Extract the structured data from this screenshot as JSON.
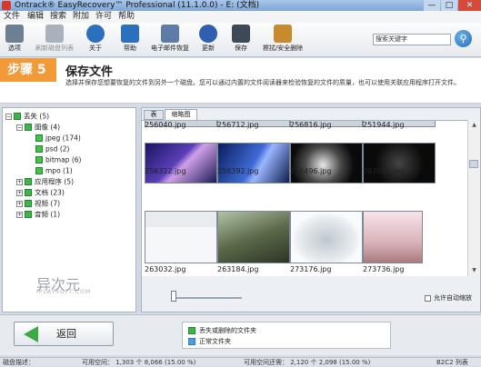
{
  "window": {
    "title": "Ontrack® EasyRecovery™ Professional (11.1.0.0) - E: (文档)",
    "min": "—",
    "max": "□",
    "close": "✕"
  },
  "menu": [
    "文件",
    "编辑",
    "搜索",
    "附加",
    "许可",
    "帮助"
  ],
  "toolbar": [
    {
      "label": "选项",
      "icon": "wrench-screwdriver-icon",
      "color": "#6d7f93",
      "enabled": true
    },
    {
      "label": "刷新磁盘列表",
      "icon": "disk-refresh-icon",
      "color": "#a9b1bb",
      "enabled": false
    },
    {
      "label": "关于",
      "icon": "info-icon",
      "color": "#2b6fbf",
      "enabled": true
    },
    {
      "label": "帮助",
      "icon": "help-icon",
      "color": "#2b6fbf",
      "enabled": true
    },
    {
      "label": "电子邮件恢复",
      "icon": "email-recovery-icon",
      "color": "#5d7da8",
      "enabled": true
    },
    {
      "label": "更新",
      "icon": "update-icon",
      "color": "#2f5fae",
      "enabled": true
    },
    {
      "label": "保存",
      "icon": "save-icon",
      "color": "#3d4956",
      "enabled": true
    },
    {
      "label": "擦拭/安全删除",
      "icon": "broom-icon",
      "color": "#c9892d",
      "enabled": true
    }
  ],
  "search": {
    "placeholder": "搜索关键字",
    "button_icon": "search-icon"
  },
  "step": {
    "label": "步骤 5",
    "title": "保存文件",
    "description": "选择并保存您想要恢复的文件到另外一个磁盘。您可以通过内置的文件阅读器来检验恢复的文件的质量，也可以使用关联应用程序打开文件。"
  },
  "tree": [
    {
      "label": "丢失",
      "count": "(5)",
      "level": 0,
      "expander": "−"
    },
    {
      "label": "图像",
      "count": "(4)",
      "level": 1,
      "expander": "−"
    },
    {
      "label": "jpeg",
      "count": "(174)",
      "level": 2,
      "expander": ""
    },
    {
      "label": "psd",
      "count": "(2)",
      "level": 2,
      "expander": ""
    },
    {
      "label": "bitmap",
      "count": "(6)",
      "level": 2,
      "expander": ""
    },
    {
      "label": "mpo",
      "count": "(1)",
      "level": 2,
      "expander": ""
    },
    {
      "label": "应用程序",
      "count": "(5)",
      "level": 1,
      "expander": "+"
    },
    {
      "label": "文档",
      "count": "(23)",
      "level": 1,
      "expander": "+"
    },
    {
      "label": "视频",
      "count": "(7)",
      "level": 1,
      "expander": "+"
    },
    {
      "label": "音频",
      "count": "(1)",
      "level": 1,
      "expander": "+"
    }
  ],
  "watermark": {
    "logo": "异次元",
    "sub": "IPLAYSOFT.COM"
  },
  "tabs": {
    "table": "表",
    "thumbnails": "缩略图"
  },
  "thumbnails": [
    {
      "name": "256040.jpg",
      "bg": "#cdd3da"
    },
    {
      "name": "256712.jpg",
      "bg": "#cfd5dc"
    },
    {
      "name": "256816.jpg",
      "bg": "#ccd2d9"
    },
    {
      "name": "251944.jpg",
      "bg": "#d0d6dd"
    },
    {
      "name": "256312.jpg",
      "bg": "linear-gradient(135deg,#1a1460,#5a3fb8 45%,#d0a0e8 55%,#1a1a55)"
    },
    {
      "name": "256392.jpg",
      "bg": "linear-gradient(120deg,#0b1c5a,#3f6bd6 50%,#9ab6ff 60%,#0e1d4c)"
    },
    {
      "name": "256496.jpg",
      "bg": "radial-gradient(circle at 45% 55%,#e8e8e8,#4a4a4a 40%,#0a0a0a 70%)"
    },
    {
      "name": "262632.jpg",
      "bg": "radial-gradient(circle at 50% 50%,#444,#0a0a0a 60%)"
    },
    {
      "name": "263032.jpg",
      "bg": "linear-gradient(#e9ecef 30%,#f6f7f8 30%)"
    },
    {
      "name": "263184.jpg",
      "bg": "linear-gradient(160deg,#b3c3a6,#5b6a4a 50%,#2c3424)"
    },
    {
      "name": "273176.jpg",
      "bg": "radial-gradient(ellipse at 50% 55%,#bfc7cf,#e8ecef 55%,#fafbfc 70%)"
    },
    {
      "name": "273736.jpg",
      "bg": "linear-gradient(#f6e4ea,#d9b3b9 60%,#a87b7e)"
    }
  ],
  "zoom": {
    "auto_zoom_label": "允许自动缩放"
  },
  "back_button": {
    "label": "返回"
  },
  "legend": [
    {
      "label": "丢失或删除的文件夹",
      "color": "#3db54a"
    },
    {
      "label": "正常文件夹",
      "color": "#4f9ee3"
    }
  ],
  "status": [
    {
      "text": "磁盘描述："
    },
    {
      "text": "可用空间：  1,303 个 8,066 (15.00 %)"
    },
    {
      "text": "可用空间还需：  2,120 个 2,098 (15.00 %)"
    },
    {
      "text": "B2C2 列表"
    }
  ]
}
